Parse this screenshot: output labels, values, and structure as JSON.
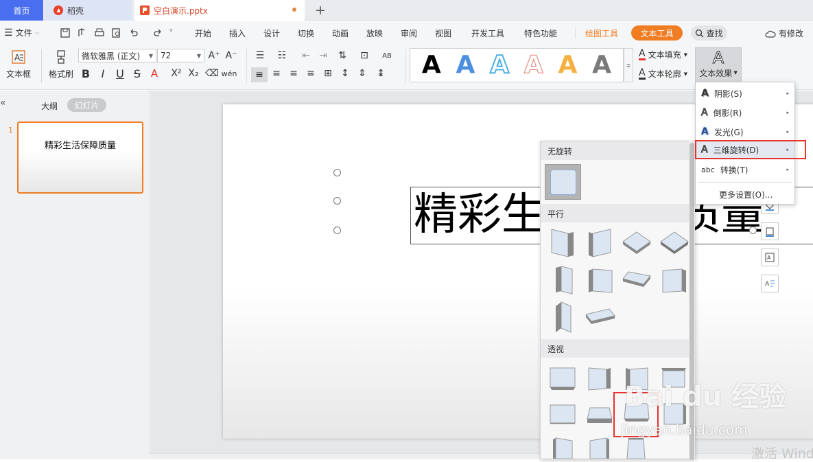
{
  "tabs": {
    "home": "首页",
    "docer": "稻壳",
    "file": "空白演示.pptx",
    "add": "+"
  },
  "menu": {
    "file": "文件",
    "items": [
      "开始",
      "插入",
      "设计",
      "切换",
      "动画",
      "放映",
      "审阅",
      "视图",
      "开发工具",
      "特色功能"
    ],
    "draw_tools": "绘图工具",
    "text_tools": "文本工具",
    "search": "查找",
    "modified": "有修改"
  },
  "ribbon": {
    "textbox": "文本框",
    "format_painter": "格式刷",
    "font": "微软雅黑 (正文)",
    "size": "72",
    "fill": "文本填充",
    "outline": "文本轮廓",
    "effect": "文本效果",
    "gallery_letter": "A",
    "colors": {
      "accent": "#f07d23",
      "blue": "#4a8fe0",
      "home": "#4a6ef0"
    }
  },
  "left": {
    "outline": "大纲",
    "slides": "幻灯片",
    "collapse": "«",
    "slide_num": "1",
    "thumb_text": "精彩生活保障质量"
  },
  "slide": {
    "title": "精彩生活保障质量"
  },
  "panel": {
    "no_rotation": "无旋转",
    "parallel": "平行",
    "perspective": "透视"
  },
  "context_menu": [
    {
      "label": "阴影(S)",
      "icon": "shadow-icon",
      "arrow": "▸"
    },
    {
      "label": "倒影(R)",
      "icon": "reflection-icon",
      "arrow": "▸"
    },
    {
      "label": "发光(G)",
      "icon": "glow-icon",
      "arrow": "▸"
    },
    {
      "label": "三维旋转(D)",
      "icon": "3d-rotation-icon",
      "arrow": "▸"
    },
    {
      "label": "转换(T)",
      "icon": "abc-icon",
      "arrow": "▸"
    },
    {
      "label": "更多设置(O)...",
      "icon": "",
      "arrow": ""
    }
  ],
  "watermark": {
    "baidu": "Bai du 经验",
    "site": "jingyan.baidu.com",
    "activate": "激活 Wind"
  }
}
